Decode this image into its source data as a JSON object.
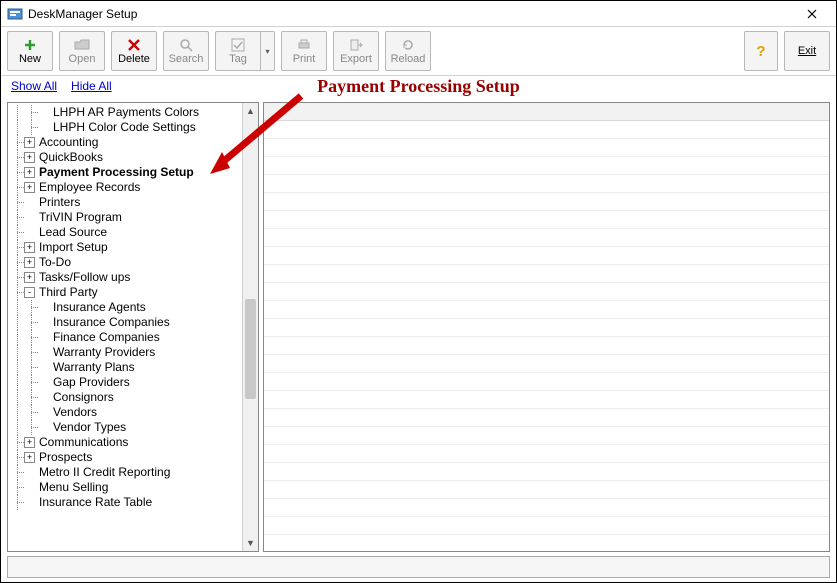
{
  "window": {
    "title": "DeskManager Setup"
  },
  "toolbar": {
    "new": "New",
    "open": "Open",
    "delete": "Delete",
    "search": "Search",
    "tag": "Tag",
    "print": "Print",
    "export": "Export",
    "reload": "Reload",
    "exit": "Exit"
  },
  "links": {
    "show_all": "Show All",
    "hide_all": "Hide All"
  },
  "page_title": "Payment Processing Setup",
  "tree": {
    "n0": "LHPH AR Payments Colors",
    "n1": "LHPH Color Code Settings",
    "n2": "Accounting",
    "n3": "QuickBooks",
    "n4": "Payment Processing Setup",
    "n5": "Employee Records",
    "n6": "Printers",
    "n7": "TriVIN Program",
    "n8": "Lead Source",
    "n9": "Import Setup",
    "n10": "To-Do",
    "n11": "Tasks/Follow ups",
    "n12": "Third Party",
    "n13": "Insurance Agents",
    "n14": "Insurance Companies",
    "n15": "Finance Companies",
    "n16": "Warranty Providers",
    "n17": "Warranty Plans",
    "n18": "Gap Providers",
    "n19": "Consignors",
    "n20": "Vendors",
    "n21": "Vendor Types",
    "n22": "Communications",
    "n23": "Prospects",
    "n24": "Metro II Credit Reporting",
    "n25": "Menu Selling",
    "n26": "Insurance Rate Table"
  }
}
